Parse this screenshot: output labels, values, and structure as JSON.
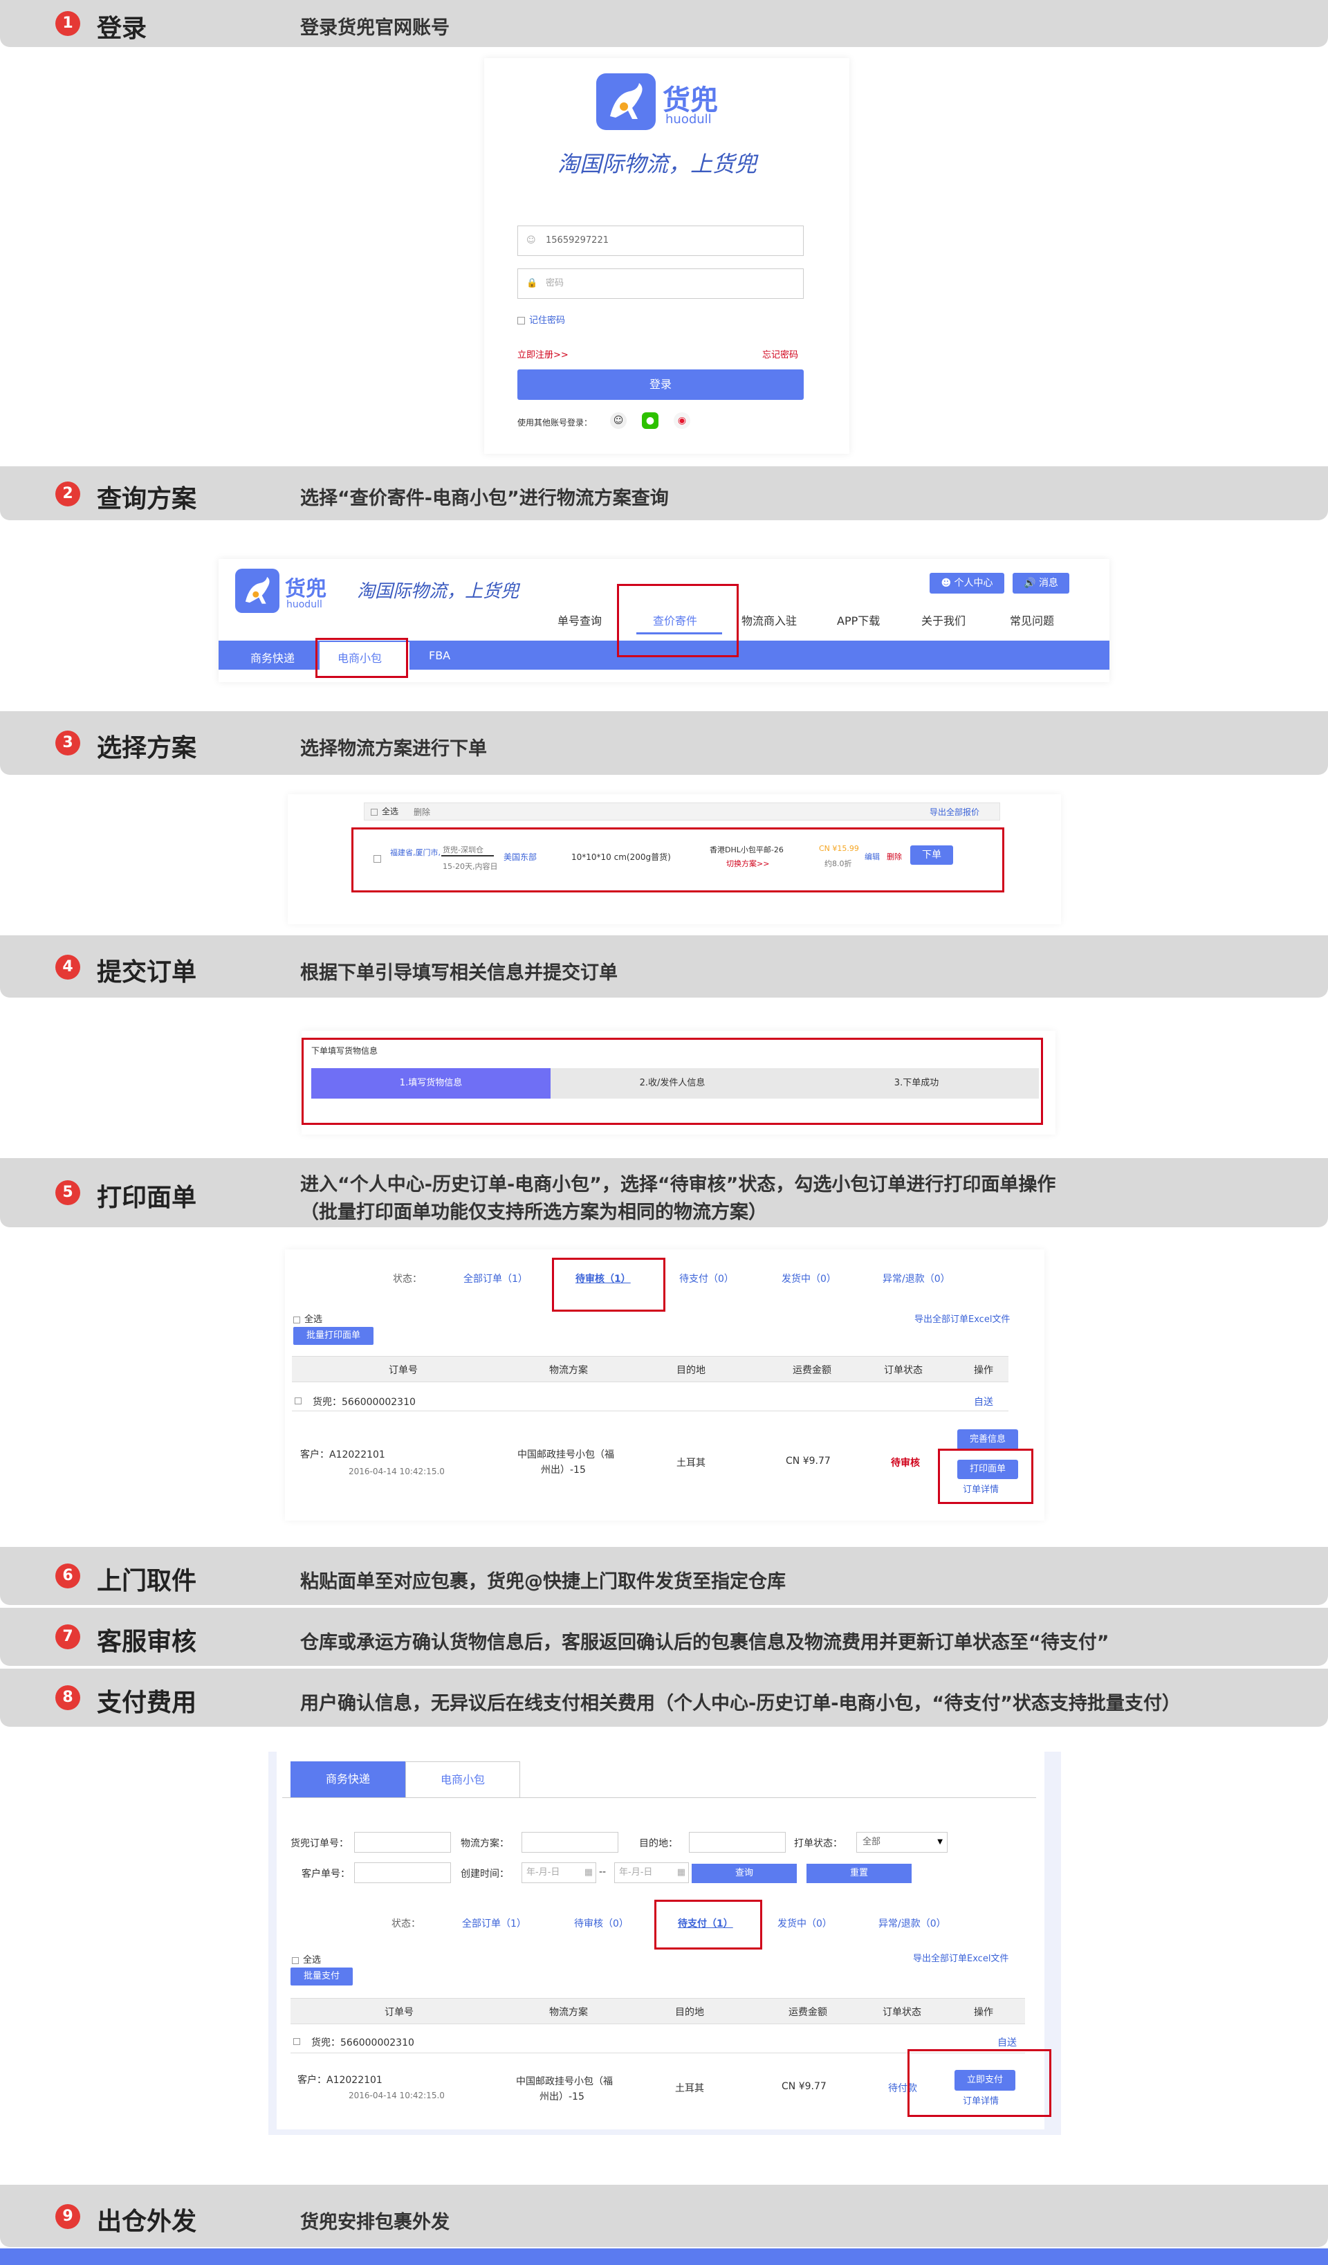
{
  "colors": {
    "accent": "#5b7bf0",
    "step_badge": "#e53935",
    "highlight": "#d0021b",
    "bar": "#d9d9d9",
    "footer": "#5b7bf0"
  },
  "steps": [
    {
      "num": "1",
      "title": "登录",
      "desc": "登录货兜官网账号"
    },
    {
      "num": "2",
      "title": "查询方案",
      "desc": "选择“查价寄件-电商小包”进行物流方案查询"
    },
    {
      "num": "3",
      "title": "选择方案",
      "desc": "选择物流方案进行下单"
    },
    {
      "num": "4",
      "title": "提交订单",
      "desc": "根据下单引导填写相关信息并提交订单"
    },
    {
      "num": "5",
      "title": "打印面单",
      "desc": "进入“个人中心-历史订单-电商小包”，选择“待审核”状态，勾选小包订单进行打印面单操作",
      "desc2": "（批量打印面单功能仅支持所选方案为相同的物流方案）"
    },
    {
      "num": "6",
      "title": "上门取件",
      "desc": "粘贴面单至对应包裹，货兜@快捷上门取件发货至指定仓库"
    },
    {
      "num": "7",
      "title": "客服审核",
      "desc": "仓库或承运方确认货物信息后，客服返回确认后的包裹信息及物流费用并更新订单状态至“待支付”"
    },
    {
      "num": "8",
      "title": "支付费用",
      "desc": "用户确认信息，无异议后在线支付相关费用（个人中心-历史订单-电商小包，“待支付”状态支持批量支付）"
    },
    {
      "num": "9",
      "title": "出仓外发",
      "desc": "货兜安排包裹外发"
    }
  ],
  "login": {
    "logo_cn": "货兜",
    "logo_en": "huodull",
    "slogan": "淘国际物流，上货兜",
    "phone": "15659297221",
    "password_placeholder": "密码",
    "remember": "记住密码",
    "register": "立即注册>>",
    "forgot": "忘记密码",
    "login_btn": "登录",
    "other_login": "使用其他账号登录："
  },
  "nav": {
    "logo_cn": "货兜",
    "logo_en": "huodull",
    "slogan": "淘国际物流，上货兜",
    "user_center": "个人中心",
    "messages": "消息",
    "items": [
      "单号查询",
      "查价寄件",
      "物流商入驻",
      "APP下载",
      "关于我们",
      "常见问题"
    ],
    "subnav": [
      "商务快递",
      "电商小包",
      "FBA"
    ]
  },
  "plan": {
    "select_all": "全选",
    "delete": "删除",
    "export": "导出全部报价",
    "origin": "福建省,厦门市,",
    "route_top": "货兜-深圳仓",
    "route_bottom": "15-20天,内容日",
    "dest": "美国东部",
    "size": "10*10*10 cm(200g普货)",
    "carrier": "香港DHL小包平邮-26",
    "carrier_link": "切换方案>>",
    "price": "CN ¥15.99",
    "weight": "约8.0折",
    "edit": "编辑",
    "del": "删除",
    "order_btn": "下单"
  },
  "orderform": {
    "title": "下单填写货物信息",
    "steps": [
      "1.填写货物信息",
      "2.收/发件人信息",
      "3.下单成功"
    ]
  },
  "print": {
    "status_label": "状态：",
    "tabs": [
      "全部订单（1）",
      "待审核（1）",
      "待支付（0）",
      "发货中（0）",
      "异常/退款（0）"
    ],
    "select_all": "全选",
    "batch_btn": "批量打印面单",
    "export": "导出全部订单Excel文件",
    "headers": [
      "订单号",
      "物流方案",
      "目的地",
      "运费金额",
      "订单状态",
      "操作"
    ],
    "order_no": "货兜：566000002310",
    "self_send": "自送",
    "customer": "客户：A12022101",
    "time": "2016-04-14 10:42:15.0",
    "plan_line1": "中国邮政挂号小包（福",
    "plan_line2": "州出）-15",
    "dest": "土耳其",
    "amount": "CN ¥9.77",
    "status": "待审核",
    "btn1": "完善信息",
    "btn2": "打印面单",
    "detail": "订单详情"
  },
  "pay": {
    "tabs_top": [
      "商务快递",
      "电商小包"
    ],
    "f_order": "货兜订单号：",
    "f_plan": "物流方案：",
    "f_dest": "目的地：",
    "f_status": "打单状态：",
    "f_status_val": "全部",
    "f_cust": "客户单号：",
    "f_time": "创建时间：",
    "date_ph": "年-月-日",
    "query": "查询",
    "reset": "重置",
    "status_label": "状态：",
    "tabs": [
      "全部订单（1）",
      "待审核（0）",
      "待支付（1）",
      "发货中（0）",
      "异常/退款（0）"
    ],
    "select_all": "全选",
    "batch_btn": "批量支付",
    "export": "导出全部订单Excel文件",
    "headers": [
      "订单号",
      "物流方案",
      "目的地",
      "运费金额",
      "订单状态",
      "操作"
    ],
    "order_no": "货兜：566000002310",
    "self_send": "自送",
    "customer": "客户：A12022101",
    "time": "2016-04-14 10:42:15.0",
    "plan_line1": "中国邮政挂号小包（福",
    "plan_line2": "州出）-15",
    "dest": "土耳其",
    "amount": "CN ¥9.77",
    "status": "待付款",
    "btn": "立即支付",
    "detail": "订单详情"
  }
}
